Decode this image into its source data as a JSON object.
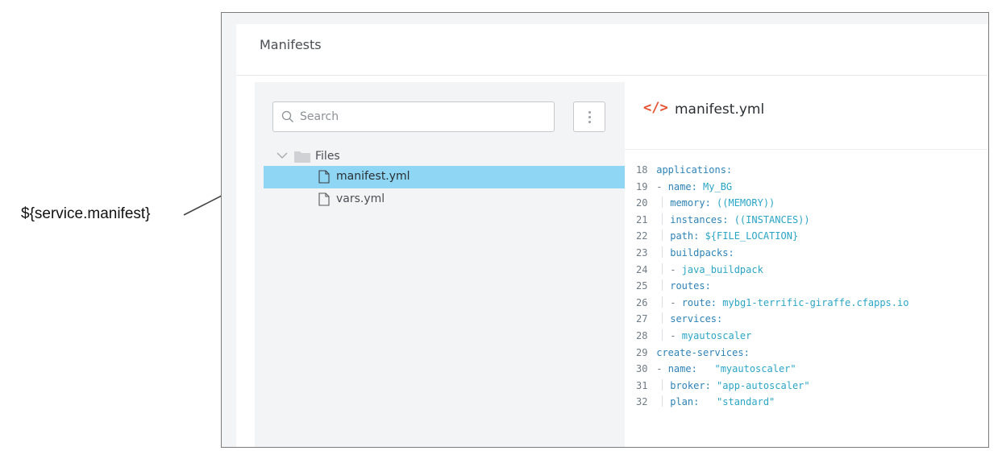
{
  "annotation": {
    "label": "${service.manifest}"
  },
  "panel": {
    "title": "Manifests"
  },
  "search": {
    "placeholder": "Search",
    "value": ""
  },
  "tree": {
    "folder": {
      "label": "Files",
      "icon": "folder-icon",
      "expanded": true
    },
    "files": [
      {
        "label": "manifest.yml",
        "icon": "file-icon",
        "selected": true
      },
      {
        "label": "vars.yml",
        "icon": "file-icon",
        "selected": false
      }
    ]
  },
  "editor": {
    "icon_glyph": "</>",
    "filename": "manifest.yml",
    "lines": [
      {
        "num": "18",
        "guide": false,
        "dash": "",
        "key": "applications:",
        "value": ""
      },
      {
        "num": "19",
        "guide": false,
        "dash": "- ",
        "key": "name:",
        "value": " My_BG"
      },
      {
        "num": "20",
        "guide": true,
        "dash": "",
        "key": "memory:",
        "value": " ((MEMORY))"
      },
      {
        "num": "21",
        "guide": true,
        "dash": "",
        "key": "instances:",
        "value": " ((INSTANCES))"
      },
      {
        "num": "22",
        "guide": true,
        "dash": "",
        "key": "path:",
        "value": " ${FILE_LOCATION}"
      },
      {
        "num": "23",
        "guide": true,
        "dash": "",
        "key": "buildpacks:",
        "value": ""
      },
      {
        "num": "24",
        "guide": true,
        "dash": "- ",
        "key": "",
        "value": "java_buildpack"
      },
      {
        "num": "25",
        "guide": true,
        "dash": "",
        "key": "routes:",
        "value": ""
      },
      {
        "num": "26",
        "guide": true,
        "dash": "- ",
        "key": "route:",
        "value": " mybg1-terrific-giraffe.cfapps.io"
      },
      {
        "num": "27",
        "guide": true,
        "dash": "",
        "key": "services:",
        "value": ""
      },
      {
        "num": "28",
        "guide": true,
        "dash": "- ",
        "key": "",
        "value": "myautoscaler"
      },
      {
        "num": "29",
        "guide": false,
        "dash": "",
        "key": "create-services:",
        "value": ""
      },
      {
        "num": "30",
        "guide": false,
        "dash": "- ",
        "key": "name:",
        "value": "   \"myautoscaler\""
      },
      {
        "num": "31",
        "guide": true,
        "dash": "",
        "key": "broker:",
        "value": " \"app-autoscaler\""
      },
      {
        "num": "32",
        "guide": true,
        "dash": "",
        "key": "plan:",
        "value": "   \"standard\""
      }
    ]
  },
  "colors": {
    "selection": "#8ed6f4",
    "code_icon": "#e5502f",
    "code_text": "#2aa5c6",
    "code_key": "#2d82b7"
  }
}
